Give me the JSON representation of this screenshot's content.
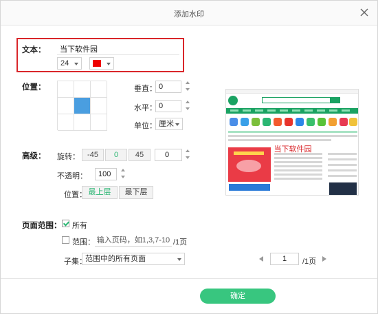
{
  "dialog": {
    "title": "添加水印",
    "close_icon": "close-icon"
  },
  "text_section": {
    "label": "文本",
    "value": "当下软件园",
    "font_size": "24",
    "color": "#ee0000"
  },
  "position_section": {
    "label": "位置",
    "grid_selected": "center",
    "vertical_label": "垂直",
    "vertical_value": "0",
    "horizontal_label": "水平",
    "horizontal_value": "0",
    "unit_label": "单位",
    "unit_value": "厘米"
  },
  "advanced_section": {
    "label": "高级",
    "rotate_label": "旋转",
    "rotate_presets": [
      "-45",
      "0",
      "45"
    ],
    "rotate_value": "0",
    "opacity_label": "不透明",
    "opacity_value": "100",
    "layer_label": "位置",
    "layer_top": "最上层",
    "layer_bottom": "最下层"
  },
  "page_range": {
    "label": "页面范围",
    "all_label": "所有",
    "all_checked": true,
    "range_label": "范围",
    "range_checked": false,
    "range_placeholder": "输入页码，如1,3,7-10",
    "range_total": "/1页",
    "subset_label": "子集",
    "subset_value": "范围中的所有页面"
  },
  "preview": {
    "watermark_text": "当下软件园",
    "page_current": "1",
    "page_total": "/1页",
    "brand_color": "#1aa262"
  },
  "footer": {
    "ok_label": "确定",
    "accent": "#38c67f"
  }
}
